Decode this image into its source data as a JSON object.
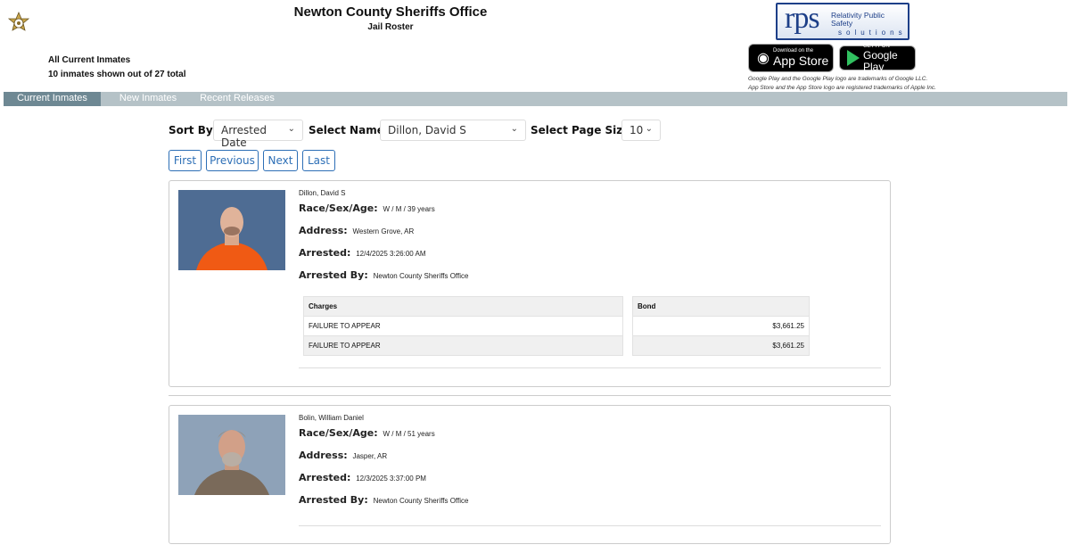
{
  "header": {
    "title": "Newton County Sheriffs Office",
    "subtitle": "Jail Roster",
    "summary_title": "All Current Inmates",
    "summary_count": "10 inmates shown out of 27 total"
  },
  "brand": {
    "logo_mark": "rps",
    "logo_name_line1": "Relativity Public Safety",
    "logo_name_line2": "solutions",
    "color": "#1d3f88"
  },
  "stores": {
    "appstore_small": "Download on the",
    "appstore_big": "App Store",
    "googleplay_small": "GET IT ON",
    "googleplay_big": "Google Play",
    "disclaimer1": "Google Play and the Google Play logo are trademarks of Google LLC.",
    "disclaimer2": "App Store and the App Store logo are registered trademarks of Apple Inc."
  },
  "tabs": [
    {
      "label": "Current Inmates",
      "active": true
    },
    {
      "label": "New Inmates",
      "active": false
    },
    {
      "label": "Recent Releases",
      "active": false
    }
  ],
  "controls": {
    "sort_label": "Sort By:",
    "sort_value": "Arrested Date",
    "name_label": "Select Name:",
    "name_value": "Dillon, David S",
    "pagesize_label": "Select Page Size:",
    "pagesize_value": "10"
  },
  "pager": {
    "first": "First",
    "previous": "Previous",
    "next": "Next",
    "last": "Last"
  },
  "labels": {
    "race_sex_age": "Race/Sex/Age:",
    "address": "Address:",
    "arrested": "Arrested:",
    "arrested_by": "Arrested By:",
    "charges": "Charges",
    "bond": "Bond"
  },
  "inmates": [
    {
      "name": "Dillon, David S",
      "race_sex_age": "W / M / 39 years",
      "address": "Western Grove, AR",
      "arrested": "12/4/2025 3:26:00 AM",
      "arrested_by": "Newton County Sheriffs Office",
      "charges": [
        {
          "charge": "FAILURE TO APPEAR",
          "bond": "$3,661.25"
        },
        {
          "charge": "FAILURE TO APPEAR",
          "bond": "$3,661.25"
        }
      ]
    },
    {
      "name": "Bolin, William Daniel",
      "race_sex_age": "W / M / 51 years",
      "address": "Jasper, AR",
      "arrested": "12/3/2025 3:37:00 PM",
      "arrested_by": "Newton County Sheriffs Office"
    }
  ]
}
